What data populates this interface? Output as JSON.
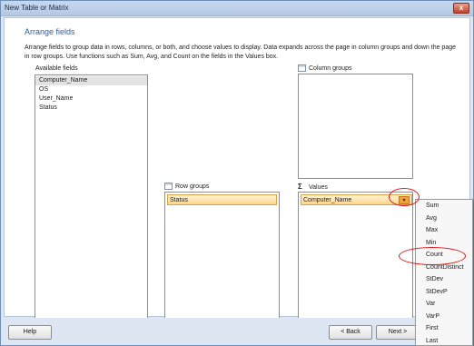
{
  "window": {
    "title": "New Table or Matrix",
    "close_glyph": "x"
  },
  "page": {
    "heading": "Arrange fields",
    "description": "Arrange fields to group data in rows, columns, or both, and choose values to display. Data expands across the page in column groups and down the page in row groups.  Use functions such as Sum, Avg, and Count on the fields in the Values box."
  },
  "available_fields": {
    "label": "Available fields",
    "items": [
      "Computer_Name",
      "OS",
      "User_Name",
      "Status"
    ],
    "selected_index": 0
  },
  "column_groups": {
    "label": "Column groups",
    "icon": "table-icon"
  },
  "row_groups": {
    "label": "Row groups",
    "icon": "table-icon",
    "items": [
      "Status"
    ]
  },
  "values": {
    "label": "Values",
    "icon": "sigma-icon",
    "sigma_glyph": "Σ",
    "items": [
      "Computer_Name"
    ],
    "dropdown_glyph": "▾"
  },
  "aggregate_menu": {
    "items": [
      "Sum",
      "Avg",
      "Max",
      "Min",
      "Count",
      "CountDistinct",
      "StDev",
      "StDevP",
      "Var",
      "VarP",
      "First",
      "Last"
    ],
    "highlighted": "Count"
  },
  "footer": {
    "help_label": "Help",
    "back_label": "< Back",
    "next_label": "Next >"
  },
  "colors": {
    "accent": "#2c5aa0",
    "pill": "#ffd58a",
    "annotation": "#e01818"
  }
}
